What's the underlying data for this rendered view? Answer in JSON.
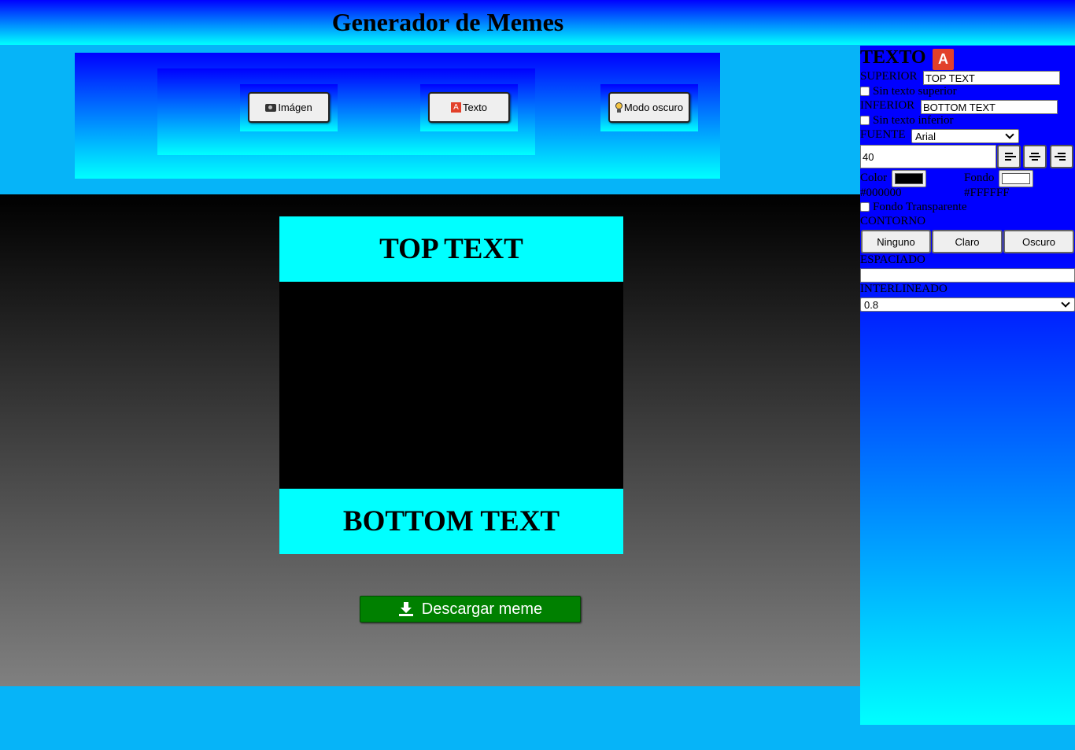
{
  "header": {
    "title": "Generador de Memes"
  },
  "toolbar": {
    "image_label": "Imágen",
    "text_label": "Texto",
    "dark_mode_label": "Modo oscuro",
    "text_icon_glyph": "A"
  },
  "meme": {
    "top_text": "TOP TEXT",
    "bottom_text": "BOTTOM TEXT"
  },
  "download": {
    "label": "Descargar meme"
  },
  "panel": {
    "title": "TEXTO",
    "title_icon_glyph": "A",
    "superior_label": "SUPERIOR",
    "superior_value": "TOP TEXT",
    "no_top_text_label": "Sin texto superior",
    "inferior_label": "INFERIOR",
    "inferior_value": "BOTTOM TEXT",
    "no_bottom_text_label": "Sin texto inferior",
    "font_label": "FUENTE",
    "font_value": "Arial",
    "font_size_value": "40",
    "color_label": "Color",
    "color_value": "#000000",
    "bg_label": "Fondo",
    "bg_value": "#FFFFFF",
    "transparent_bg_label": "Fondo Transparente",
    "outline_label": "CONTORNO",
    "outline_none": "Ninguno",
    "outline_light": "Claro",
    "outline_dark": "Oscuro",
    "spacing_label": "ESPACIADO",
    "spacing_value": "",
    "line_height_label": "INTERLINEADO",
    "line_height_value": "0.8"
  },
  "colors": {
    "header_gradient": [
      "#0000ff",
      "#00ffff"
    ],
    "meme_text_bg": "#00ffff",
    "download_bg": "#008000",
    "page_bg": "#06b4f8"
  }
}
